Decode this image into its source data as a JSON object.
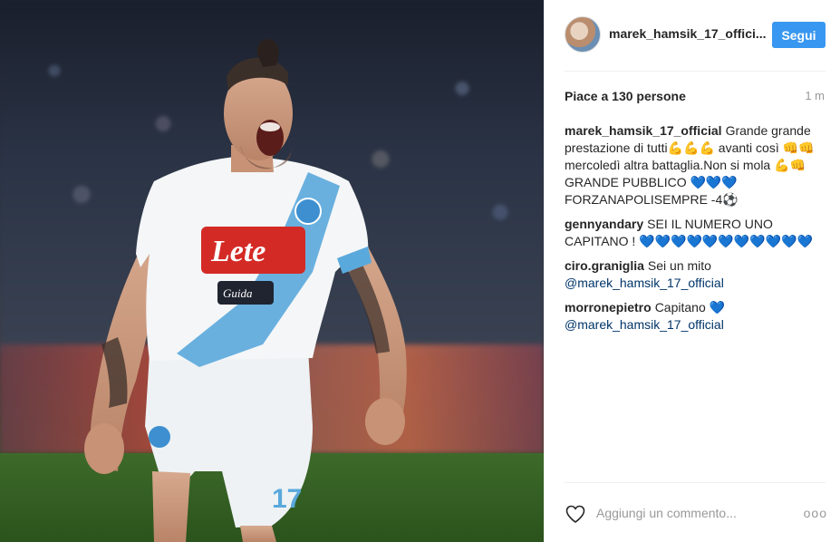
{
  "post": {
    "username": "marek_hamsik_17_offici...",
    "follow_label": "Segui",
    "likes": "Piace a 130 persone",
    "time_ago": "1 m",
    "jersey_sponsor": "Lete",
    "jersey_signature": "Guida"
  },
  "comments": [
    {
      "user": "marek_hamsik_17_official",
      "text": "Grande grande prestazione di tutti💪💪💪 avanti così 👊👊 mercoledì altra battaglia.Non si mola 💪👊 GRANDE PUBBLICO 💙💙💙 FORZANAPOLISEMPRE -4⚽",
      "mention": ""
    },
    {
      "user": "gennyandary",
      "text": "SEI IL NUMERO UNO CAPITANO ! 💙💙💙💙💙💙💙💙💙💙💙",
      "mention": ""
    },
    {
      "user": "ciro.graniglia",
      "text": "Sei un mito",
      "mention": "@marek_hamsik_17_official"
    },
    {
      "user": "morronepietro",
      "text": "Capitano 💙",
      "mention": "@marek_hamsik_17_official"
    }
  ],
  "composer": {
    "placeholder": "Aggiungi un commento...",
    "more_label": "ooo"
  },
  "colors": {
    "accent": "#3897f0",
    "mention": "#003569",
    "napoli_sky": "#5aa9dc"
  }
}
